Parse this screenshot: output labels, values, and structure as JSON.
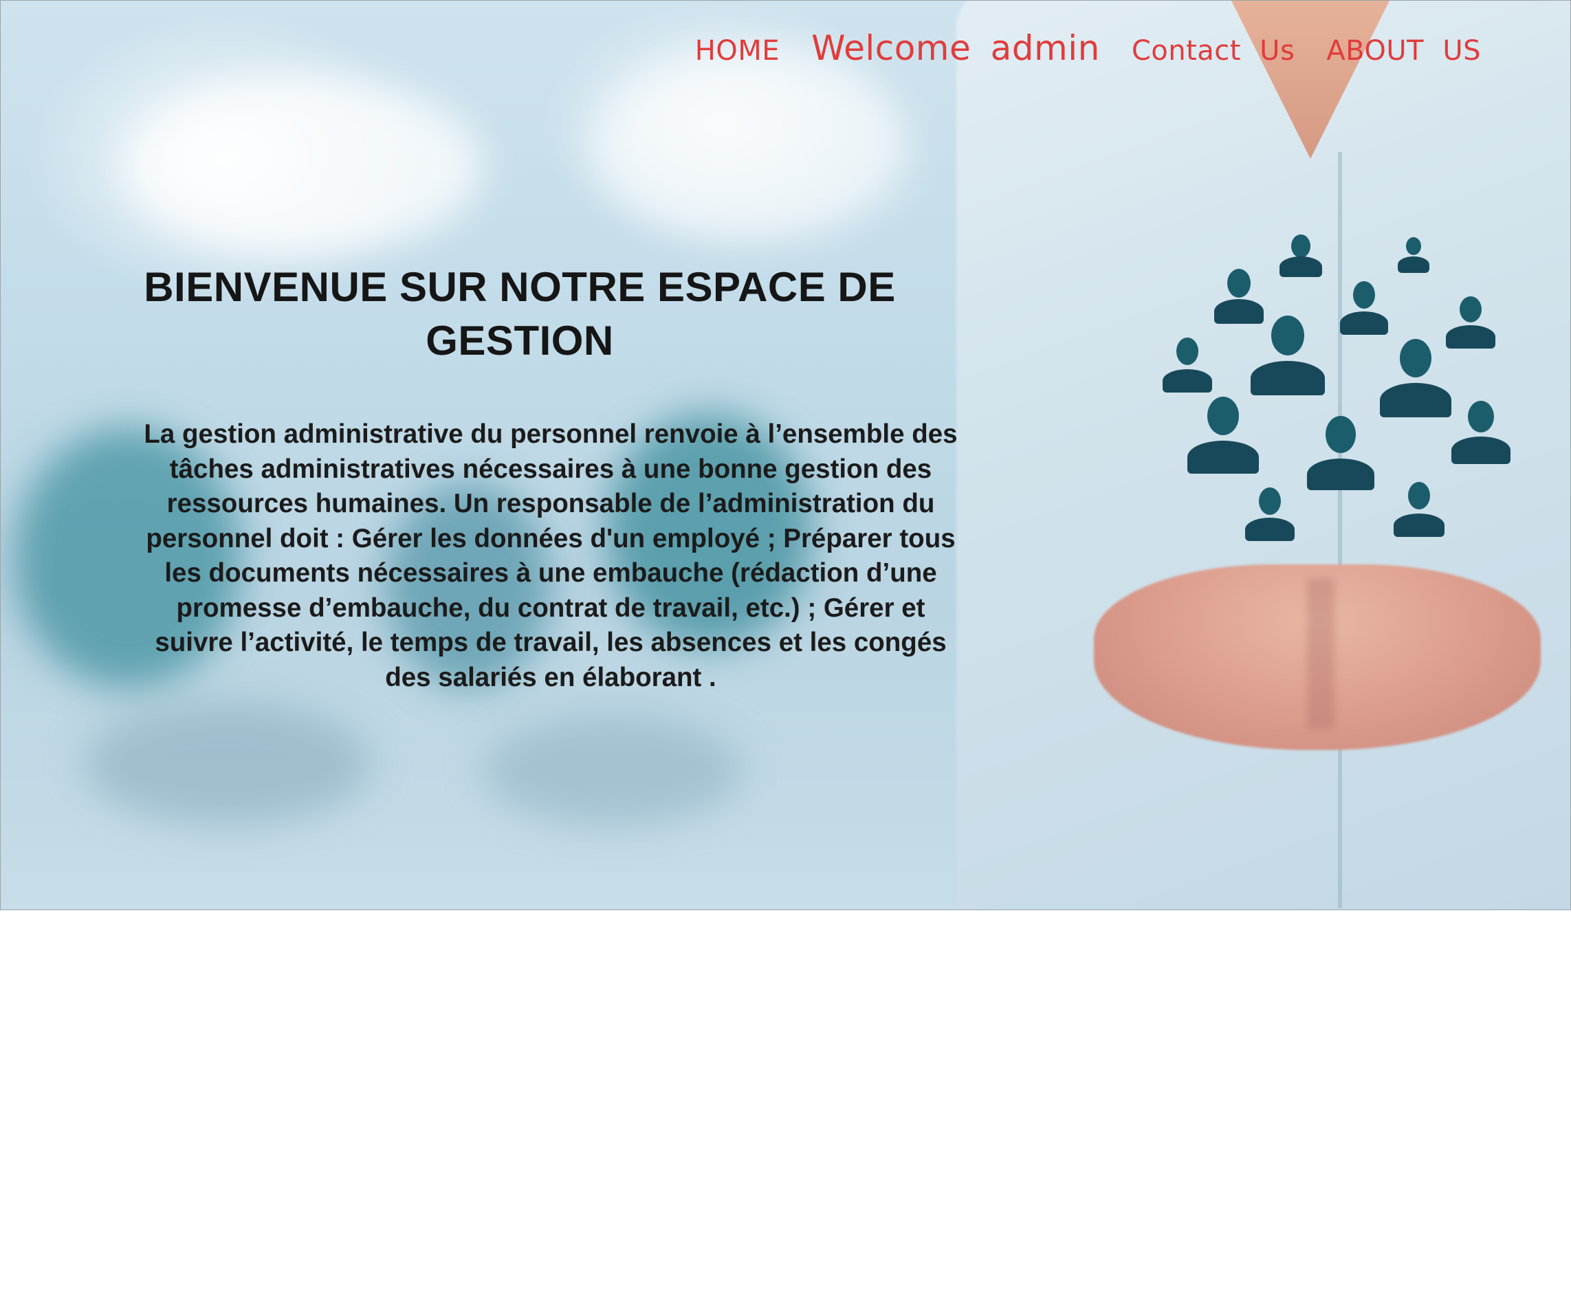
{
  "nav": {
    "home_label": "HOME",
    "welcome_text": "Welcome admin",
    "contact_label": "Contact Us",
    "about_label": "ABOUT US"
  },
  "hero": {
    "title": "BIENVENUE SUR NOTRE ESPACE DE GESTION",
    "description": "La gestion administrative du personnel renvoie à l’ensemble des tâches administratives nécessaires à une bonne gestion des ressources humaines. Un responsable de l’administration du personnel doit : Gérer les données d'un employé ; Préparer tous les documents nécessaires à une embauche (rédaction d’une promesse d’embauche, du contrat de travail, etc.) ; Gérer et suivre l’activité, le temps de travail, les absences et les congés des salariés en élaborant ."
  },
  "colors": {
    "nav_text": "#e23b3b",
    "heading_text": "#161616",
    "icon_dark": "#18495a"
  },
  "icons": [
    "people-network-icon"
  ]
}
